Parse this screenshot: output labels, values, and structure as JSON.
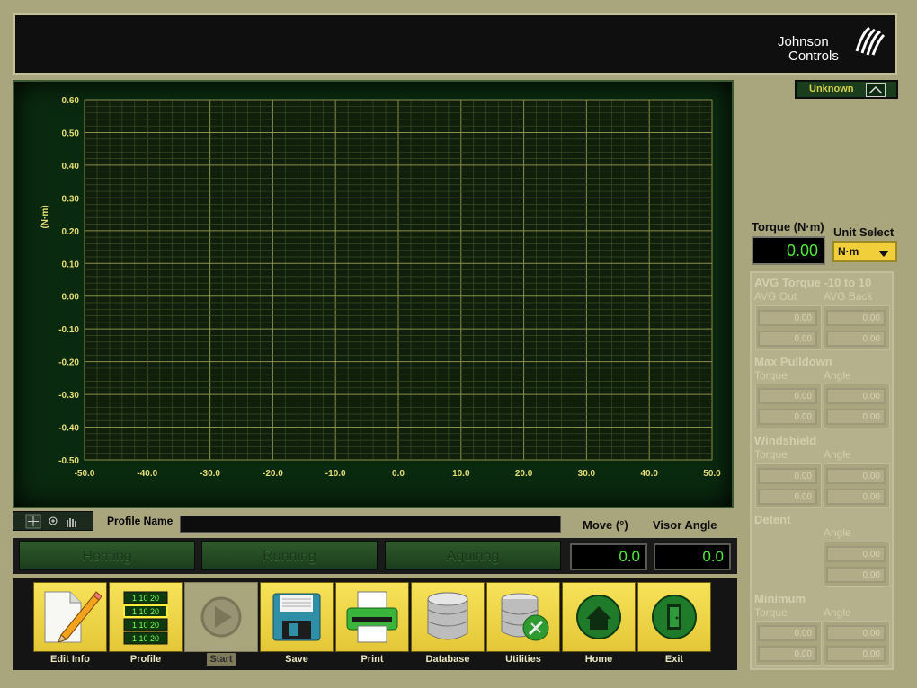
{
  "header": {
    "logo_line1": "Johnson",
    "logo_line2": "Controls"
  },
  "status_indicator": {
    "text": "Unknown"
  },
  "right_panel": {
    "torque_label": "Torque (N·m)",
    "torque_value": "0.00",
    "unit_select_label": "Unit Select",
    "unit_value": "N·m",
    "sections": [
      {
        "title": "AVG Torque -10 to 10",
        "col1": "AVG Out",
        "col2": "AVG Back",
        "values": [
          "0.00",
          "0.00",
          "0.00",
          "0.00"
        ]
      },
      {
        "title": "Max Pulldown",
        "col1": "Torque",
        "col2": "Angle",
        "values": [
          "0.00",
          "0.00",
          "0.00",
          "0.00"
        ]
      },
      {
        "title": "Windshield",
        "col1": "Torque",
        "col2": "Angle",
        "values": [
          "0.00",
          "0.00",
          "0.00",
          "0.00"
        ]
      },
      {
        "title": "Detent",
        "col1": "",
        "col2": "Angle",
        "values": [
          "0.00",
          "0.00"
        ]
      },
      {
        "title": "Minimum",
        "col1": "Torque",
        "col2": "Angle",
        "values": [
          "0.00",
          "0.00",
          "0.00",
          "0.00"
        ]
      }
    ]
  },
  "profile": {
    "label": "Profile Name",
    "value": ""
  },
  "move_label": "Move (°)",
  "visor_label": "Visor Angle",
  "move_value": "0.0",
  "visor_value": "0.0",
  "status_buttons": [
    "Homing",
    "Running",
    "Aquiring"
  ],
  "toolbar": [
    {
      "label": "Edit Info",
      "icon": "pencil-paper-icon",
      "enabled": true
    },
    {
      "label": "Profile",
      "icon": "profile-grid-icon",
      "enabled": true,
      "grid_rows": [
        "1 10 20",
        "1 10 20",
        "1 10 20",
        "1 10 20"
      ]
    },
    {
      "label": "Start",
      "icon": "play-icon",
      "enabled": false
    },
    {
      "label": "Save",
      "icon": "floppy-disk-icon",
      "enabled": true
    },
    {
      "label": "Print",
      "icon": "printer-icon",
      "enabled": true
    },
    {
      "label": "Database",
      "icon": "database-icon",
      "enabled": true
    },
    {
      "label": "Utilities",
      "icon": "database-tools-icon",
      "enabled": true
    },
    {
      "label": "Home",
      "icon": "home-icon",
      "enabled": true
    },
    {
      "label": "Exit",
      "icon": "exit-door-icon",
      "enabled": true
    }
  ],
  "colors": {
    "plot_bg": "#0a2a0f",
    "grid": "#6c7a3a",
    "tick_text": "#e8dd76",
    "value_green": "#52ea3b",
    "accent_yellow": "#f0cf3a"
  },
  "chart_data": {
    "type": "line",
    "ylabel": "(N·m)",
    "xlabel": "",
    "xlim": [
      -50,
      50
    ],
    "ylim": [
      -0.5,
      0.6
    ],
    "x_ticks": [
      -50,
      -40,
      -30,
      -20,
      -10,
      0,
      10,
      20,
      30,
      40,
      50
    ],
    "y_ticks": [
      0.6,
      0.5,
      0.4,
      0.3,
      0.2,
      0.1,
      0.0,
      -0.1,
      -0.2,
      -0.3,
      -0.4,
      -0.5
    ],
    "x_tick_labels": [
      "-50.0",
      "-40.0",
      "-30.0",
      "-20.0",
      "-10.0",
      "0.0",
      "10.0",
      "20.0",
      "30.0",
      "40.0",
      "50.0"
    ],
    "y_tick_labels": [
      "0.60",
      "0.50",
      "0.40",
      "0.30",
      "0.20",
      "0.10",
      "0.00",
      "-0.10",
      "-0.20",
      "-0.30",
      "-0.40",
      "-0.50"
    ],
    "grid": true,
    "series": []
  }
}
